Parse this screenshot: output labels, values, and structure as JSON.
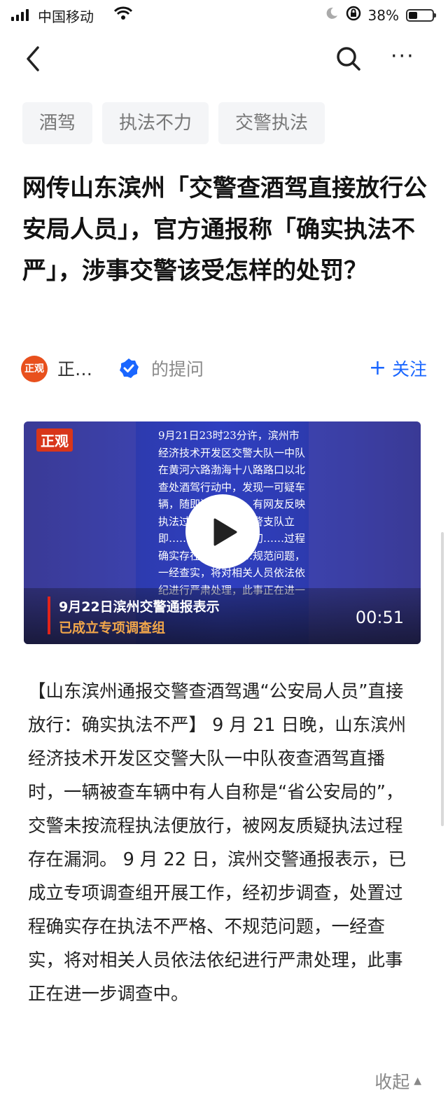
{
  "status_bar": {
    "carrier": "中国移动",
    "battery_text": "38%",
    "battery_level": 0.38
  },
  "nav": {
    "more_label": "···"
  },
  "tags": [
    "酒驾",
    "执法不力",
    "交警执法"
  ],
  "question": {
    "title": "网传山东滨州「交警查酒驾直接放行公安局人员」，官方通报称「确实执法不严」，涉事交警该受怎样的处罚？"
  },
  "author": {
    "logo_text": "正观",
    "name": "正…",
    "suffix": "的提问",
    "follow_label": "关注"
  },
  "video": {
    "logo": "正观",
    "overlay_text": "9月21日23时23分许，滨州市经济技术开发区交警大队一中队在黄河六路渤海十八路路口以北查处酒驾行动中，发现一可疑车辆，随即进行查处。有网友反映执法过程……市局交警支队立即……开展工作，经初……过程确实存在执法不……规范问题，一经查实，将对相关人员依法依纪进行严肃处理，此事正在进一",
    "caption_line1": "9月22日滨州交警通报表示",
    "caption_line2": "已成立专项调查组",
    "duration": "00:51"
  },
  "content": {
    "body": "【山东滨州通报交警查酒驾遇“公安局人员”直接放行：确实执法不严】 9 月 21 日晚，山东滨州经济技术开发区交警大队一中队夜查酒驾直播时，一辆被查车辆中有人自称是“省公安局的”，交警未按流程执法便放行，被网友质疑执法过程存在漏洞。 9 月 22 日，滨州交警通报表示，已成立专项调查组开展工作，经初步调查，处置过程确实存在执法不严格、不规范问题，一经查实，将对相关人员依法依纪进行严肃处理，此事正在进一步调查中。",
    "collapse_label": "收起"
  }
}
